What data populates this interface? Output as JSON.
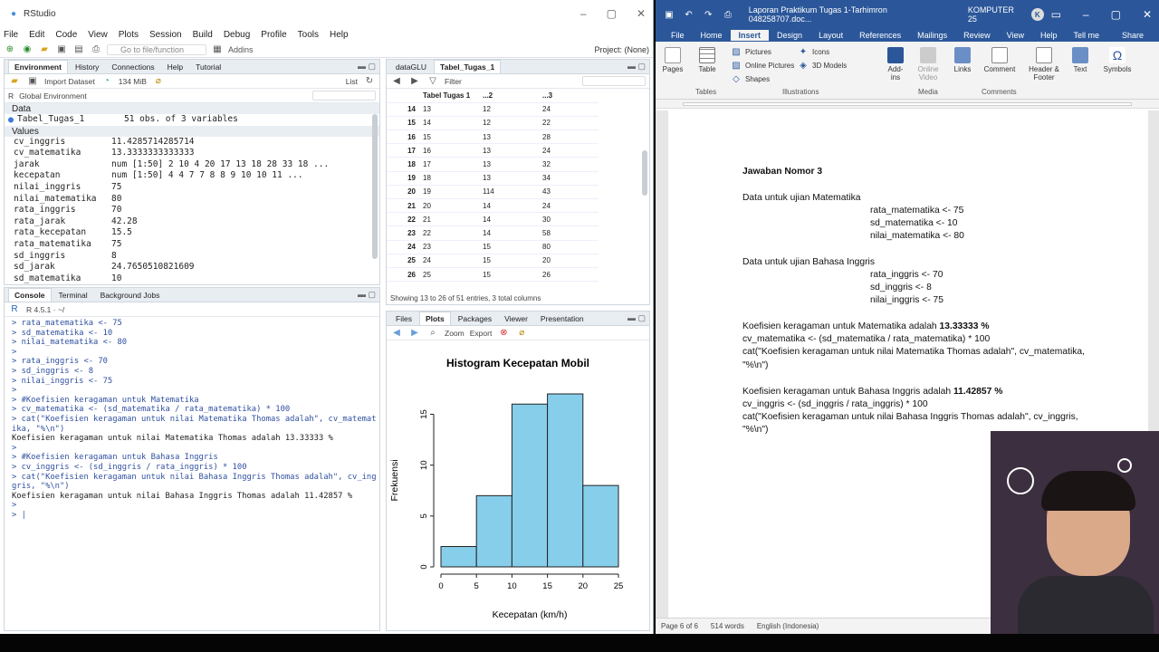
{
  "rstudio": {
    "title": "RStudio",
    "menu": [
      "File",
      "Edit",
      "Code",
      "View",
      "Plots",
      "Session",
      "Build",
      "Debug",
      "Profile",
      "Tools",
      "Help"
    ],
    "toolbar": {
      "goto_placeholder": "Go to file/function",
      "addins": "Addins",
      "project": "Project: (None)"
    },
    "env_tabs": [
      "Environment",
      "History",
      "Connections",
      "Help",
      "Tutorial"
    ],
    "env_toolbar": {
      "import": "Import Dataset",
      "memory": "134 MiB",
      "view": "List",
      "lang": "R",
      "scope": "Global Environment"
    },
    "data_header": "Data",
    "data_rows": [
      {
        "name": "Tabel_Tugas_1",
        "value": "51 obs. of 3 variables"
      }
    ],
    "values_header": "Values",
    "values": [
      {
        "name": "cv_inggris",
        "value": "11.4285714285714"
      },
      {
        "name": "cv_matematika",
        "value": "13.3333333333333"
      },
      {
        "name": "jarak",
        "value": "num [1:50] 2 10 4 20 17 13 18 28 33 18 ..."
      },
      {
        "name": "kecepatan",
        "value": "num [1:50] 4 4 7 7 8 8 9 10 10 11 ..."
      },
      {
        "name": "nilai_inggris",
        "value": "75"
      },
      {
        "name": "nilai_matematika",
        "value": "80"
      },
      {
        "name": "rata_inggris",
        "value": "70"
      },
      {
        "name": "rata_jarak",
        "value": "42.28"
      },
      {
        "name": "rata_kecepatan",
        "value": "15.5"
      },
      {
        "name": "rata_matematika",
        "value": "75"
      },
      {
        "name": "sd_inggris",
        "value": "8"
      },
      {
        "name": "sd_jarak",
        "value": "24.7650510821609"
      },
      {
        "name": "sd_matematika",
        "value": "10"
      }
    ],
    "console_tabs": [
      "Console",
      "Terminal",
      "Background Jobs"
    ],
    "console_path": "R 4.5.1 · ~/",
    "console_lines": [
      {
        "t": "cmd",
        "s": "> rata_matematika <- 75"
      },
      {
        "t": "cmd",
        "s": "> sd_matematika <- 10"
      },
      {
        "t": "cmd",
        "s": "> nilai_matematika <- 80"
      },
      {
        "t": "cmd",
        "s": ">"
      },
      {
        "t": "cmd",
        "s": "> rata_inggris <- 70"
      },
      {
        "t": "cmd",
        "s": "> sd_inggris <- 8"
      },
      {
        "t": "cmd",
        "s": "> nilai_inggris <- 75"
      },
      {
        "t": "cmd",
        "s": ">"
      },
      {
        "t": "cmd",
        "s": "> #Koefisien keragaman untuk Matematika"
      },
      {
        "t": "cmd",
        "s": "> cv_matematika <- (sd_matematika / rata_matematika) * 100"
      },
      {
        "t": "cmd",
        "s": "> cat(\"Koefisien keragaman untuk nilai Matematika Thomas adalah\", cv_matemat"
      },
      {
        "t": "cmd",
        "s": "ika, \"%\\n\")"
      },
      {
        "t": "out",
        "s": "Koefisien keragaman untuk nilai Matematika Thomas adalah 13.33333 %"
      },
      {
        "t": "cmd",
        "s": ">"
      },
      {
        "t": "cmd",
        "s": "> #Koefisien keragaman untuk Bahasa Inggris"
      },
      {
        "t": "cmd",
        "s": "> cv_inggris <- (sd_inggris / rata_inggris) * 100"
      },
      {
        "t": "cmd",
        "s": "> cat(\"Koefisien keragaman untuk nilai Bahasa Inggris Thomas adalah\", cv_ing"
      },
      {
        "t": "cmd",
        "s": "gris, \"%\\n\")"
      },
      {
        "t": "out",
        "s": "Koefisien keragaman untuk nilai Bahasa Inggris Thomas adalah 11.42857 %"
      },
      {
        "t": "cmd",
        "s": ">"
      },
      {
        "t": "cmd",
        "s": "> |"
      }
    ],
    "viewer_tabs": [
      "dataGLU",
      "Tabel_Tugas_1"
    ],
    "viewer_filter": "Filter",
    "viewer_columns": [
      "Tabel Tugas 1",
      "...2",
      "...3"
    ],
    "viewer_rows": [
      [
        "14",
        "13",
        "12",
        "24"
      ],
      [
        "15",
        "14",
        "12",
        "22"
      ],
      [
        "16",
        "15",
        "13",
        "28"
      ],
      [
        "17",
        "16",
        "13",
        "24"
      ],
      [
        "18",
        "17",
        "13",
        "32"
      ],
      [
        "19",
        "18",
        "13",
        "34"
      ],
      [
        "20",
        "19",
        "114",
        "43"
      ],
      [
        "21",
        "20",
        "14",
        "24"
      ],
      [
        "22",
        "21",
        "14",
        "30"
      ],
      [
        "23",
        "22",
        "14",
        "58"
      ],
      [
        "24",
        "23",
        "15",
        "80"
      ],
      [
        "25",
        "24",
        "15",
        "20"
      ],
      [
        "26",
        "25",
        "15",
        "26"
      ]
    ],
    "viewer_footer": "Showing 13 to 26 of 51 entries, 3 total columns",
    "files_tabs": [
      "Files",
      "Plots",
      "Packages",
      "Viewer",
      "Presentation"
    ],
    "plots_toolbar": {
      "zoom": "Zoom",
      "export": "Export"
    }
  },
  "chart_data": {
    "type": "bar",
    "title": "Histogram Kecepatan Mobil",
    "xlabel": "Kecepatan (km/h)",
    "ylabel": "Frekuensi",
    "bins": [
      [
        0,
        5
      ],
      [
        5,
        10
      ],
      [
        10,
        15
      ],
      [
        15,
        20
      ],
      [
        20,
        25
      ]
    ],
    "values": [
      2,
      7,
      16,
      17,
      8
    ],
    "xticks": [
      "0",
      "5",
      "10",
      "15",
      "20",
      "25"
    ],
    "yticks": [
      "0",
      "5",
      "10",
      "15"
    ],
    "ylim": [
      0,
      17
    ],
    "bar_color": "#87ceeb"
  },
  "word": {
    "title": "Laporan Praktikum Tugas 1-Tarhimron 048258707.doc...",
    "user": "KOMPUTER 25",
    "tabs": [
      "File",
      "Home",
      "Insert",
      "Design",
      "Layout",
      "References",
      "Mailings",
      "Review",
      "View",
      "Help",
      "Tell me",
      "Share"
    ],
    "ribbon": {
      "pages": "Pages",
      "table": "Table",
      "tables_group": "Tables",
      "pictures": "Pictures",
      "online_pictures": "Online Pictures",
      "shapes": "Shapes",
      "icons": "Icons",
      "models": "3D Models",
      "illustrations_group": "Illustrations",
      "addins": "Add-ins",
      "online_video": "Online Video",
      "media_group": "Media",
      "links": "Links",
      "comment": "Comment",
      "comments_group": "Comments",
      "header_footer": "Header & Footer",
      "text": "Text",
      "symbols": "Symbols"
    },
    "doc": {
      "heading": "Jawaban Nomor 3",
      "l1": "Data untuk ujian Matematika",
      "l2": "rata_matematika <- 75",
      "l3": "sd_matematika <- 10",
      "l4": "nilai_matematika <- 80",
      "l5": "Data untuk ujian Bahasa Inggris",
      "l6": "rata_inggris <- 70",
      "l7": "sd_inggris <- 8",
      "l8": "nilai_inggris <- 75",
      "l9a": "Koefisien keragaman untuk Matematika adalah ",
      "l9b": "13.33333 %",
      "l10": "cv_matematika <- (sd_matematika / rata_matematika) * 100",
      "l11": "cat(\"Koefisien  keragaman  untuk  nilai  Matematika  Thomas  adalah\",  cv_matematika,",
      "l12": "\"%\\n\")",
      "l13a": "Koefisien keragaman untuk Bahasa Inggris adalah ",
      "l13b": "11.42857 %",
      "l14": "cv_inggris <- (sd_inggris / rata_inggris) * 100",
      "l15": "cat(\"Koefisien  keragaman  untuk  nilai  Bahasa  Inggris  Thomas  adalah\",  cv_inggris,",
      "l16": "\"%\\n\")"
    },
    "status": {
      "page": "Page 6 of 6",
      "words": "514 words",
      "lang": "English (Indonesia)"
    }
  }
}
